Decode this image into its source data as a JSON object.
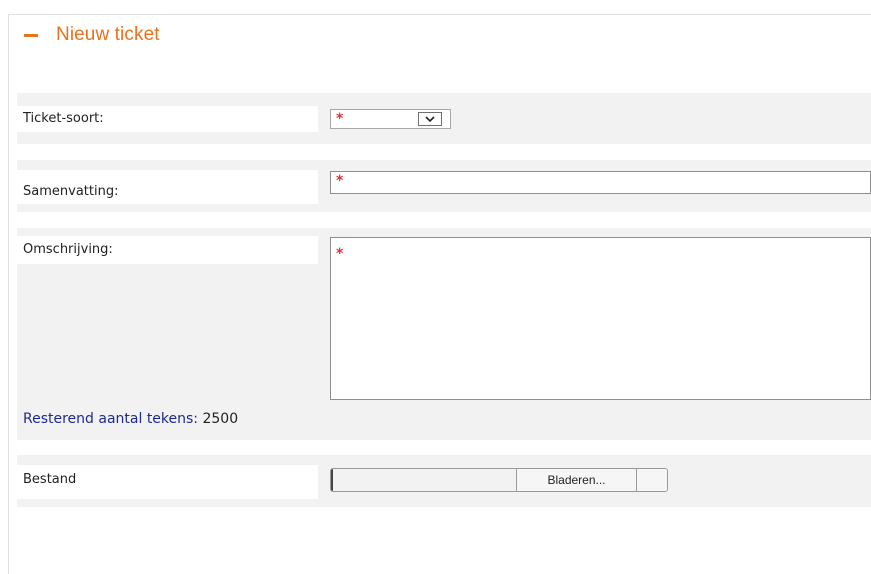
{
  "section": {
    "title": "Nieuw ticket",
    "collapse_icon": "minus-icon"
  },
  "form": {
    "ticket_type": {
      "label": "Ticket-soort:",
      "required_mark": "*",
      "selected_value": "",
      "arrow_icon": "chevron-down-icon"
    },
    "summary": {
      "label": "Samenvatting:",
      "required_mark": "*",
      "value": ""
    },
    "description": {
      "label": "Omschrijving:",
      "required_mark": "*",
      "value": ""
    },
    "remaining": {
      "label": "Resterend aantal tekens:",
      "count": "2500"
    },
    "file": {
      "label": "Bestand",
      "path_value": "",
      "browse_label": "Bladeren..."
    }
  },
  "colors": {
    "accent": "#e8731c",
    "required": "#d9303a",
    "counter_label": "#1f2b8c",
    "row_background": "#f2f2f2"
  }
}
